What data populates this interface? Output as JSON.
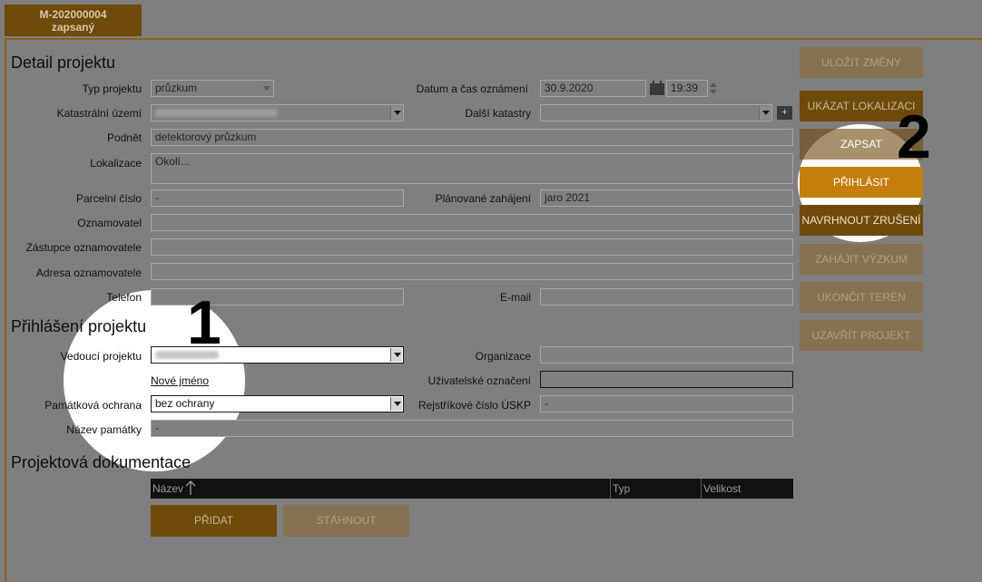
{
  "badge": {
    "id": "M-202000004",
    "state": "zapsaný"
  },
  "detail": {
    "title": "Detail projektu",
    "typ_projektu": {
      "label": "Typ projektu",
      "value": "průzkum"
    },
    "datum": {
      "label": "Datum a čas oznámení",
      "date": "30.9.2020",
      "time": "19:39"
    },
    "katastralni": {
      "label": "Katastrální území"
    },
    "dalsi_katastry": {
      "label": "Další katastry",
      "add": "+"
    },
    "podnet": {
      "label": "Podnět",
      "value": "detektorový průzkum"
    },
    "lokalizace": {
      "label": "Lokalizace",
      "placeholder": "Okolí..."
    },
    "parcelni": {
      "label": "Parcelní číslo",
      "value": "-"
    },
    "planovane": {
      "label": "Plánované zahájení",
      "value": "jaro 2021"
    },
    "oznamovatel": {
      "label": "Oznamovatel"
    },
    "zastupce": {
      "label": "Zástupce oznamovatele"
    },
    "adresa": {
      "label": "Adresa oznamovatele"
    },
    "telefon": {
      "label": "Telefon"
    },
    "email": {
      "label": "E-mail"
    }
  },
  "prihlaseni": {
    "title": "Přihlášení projektu",
    "vedouci": {
      "label": "Vedoucí projektu"
    },
    "organizace": {
      "label": "Organizace"
    },
    "nove_jmeno": "Nové jméno",
    "uzivatelske": {
      "label": "Uživatelské označení"
    },
    "pamatkova": {
      "label": "Památková ochrana",
      "value": "bez ochrany"
    },
    "rejstrikove": {
      "label": "Rejstříkové číslo ÚSKP",
      "value": "-"
    },
    "nazev_pamatky": {
      "label": "Název památky",
      "value": "-"
    }
  },
  "dokumentace": {
    "title": "Projektová dokumentace",
    "columns": [
      "Název",
      "Typ",
      "Velikost"
    ],
    "pridat": "PŘIDAT",
    "stahnout": "STÁHNOUT"
  },
  "actions": {
    "ulozit": "ULOŽIT ZMĚNY",
    "ukazat": "UKÁZAT LOKALIZACI",
    "zapsat": "ZAPSAT",
    "prihlasit": "PŘIHLÁSIT",
    "navrhnout": "NAVRHNOUT ZRUŠENÍ",
    "zahajit": "ZAHÁJIT VÝZKUM",
    "ukoncit": "UKONČIT TERÉN",
    "uzavrit": "UZAVŘÍT PROJEKT"
  },
  "markers": {
    "one": "1",
    "two": "2"
  },
  "colors": {
    "accent": "#c57e0e",
    "dark_brown": "#6e4a0c",
    "overlay": "#7f7f7f"
  },
  "icons": {
    "calendar": "calendar-icon",
    "sort": "sort-ascending-icon"
  }
}
